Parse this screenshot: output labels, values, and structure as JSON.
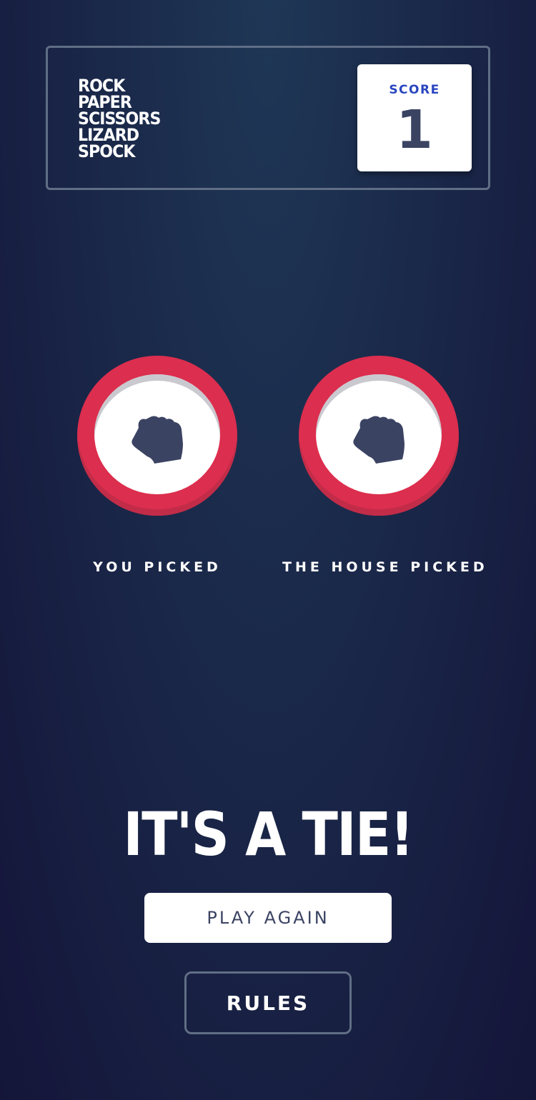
{
  "header": {
    "logo_lines": [
      "ROCK",
      "PAPER",
      "SCISSORS",
      "LIZARD",
      "SPOCK"
    ],
    "score_label": "SCORE",
    "score_value": "1"
  },
  "picks": {
    "player": {
      "label": "YOU PICKED",
      "choice_icon": "rock-icon",
      "ring_color": "#dc2e4e"
    },
    "house": {
      "label": "THE HOUSE PICKED",
      "choice_icon": "rock-icon",
      "ring_color": "#dc2e4e"
    }
  },
  "result": {
    "text": "IT'S A TIE!",
    "play_again_label": "PLAY AGAIN"
  },
  "footer": {
    "rules_label": "RULES"
  }
}
